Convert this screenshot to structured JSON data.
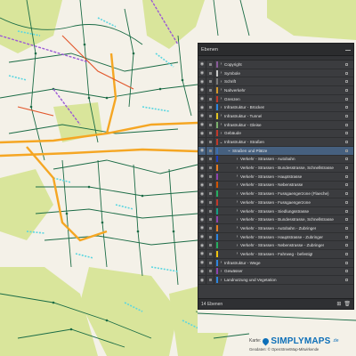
{
  "panel": {
    "title": "Ebenen",
    "footer_count": "14 Ebenen",
    "layers": [
      {
        "label": "Copyright",
        "color": "#8a5a9b",
        "caret": "›",
        "indent": 0
      },
      {
        "label": "Symbole",
        "color": "#c8c8c8",
        "caret": "›",
        "indent": 0
      },
      {
        "label": "Schrift",
        "color": "#7a7a7a",
        "caret": "›",
        "indent": 0
      },
      {
        "label": "Nahverkehr",
        "color": "#d49a2a",
        "caret": "›",
        "indent": 0
      },
      {
        "label": "Grenzen",
        "color": "#c0392b",
        "caret": "›",
        "indent": 0
      },
      {
        "label": "Infrastruktur - Brücken",
        "color": "#2e86de",
        "caret": "›",
        "indent": 0
      },
      {
        "label": "Infrastruktur - Tunnel",
        "color": "#e2c422",
        "caret": "›",
        "indent": 0
      },
      {
        "label": "Infrastruktur - Gleise",
        "color": "#7bb36b",
        "caret": "›",
        "indent": 0
      },
      {
        "label": "Gebäude",
        "color": "#c0392b",
        "caret": "›",
        "indent": 0
      },
      {
        "label": "Infrastruktur - Straßen",
        "color": "#c0392b",
        "caret": "⌄",
        "indent": 0
      },
      {
        "label": "Straßen und Plätze",
        "color": "#3b6fb0",
        "caret": "⌄",
        "indent": 1,
        "selected": true
      },
      {
        "label": "Verkehr - Strassen - Autobahn",
        "color": "#1f3fbf",
        "caret": "›",
        "indent": 2
      },
      {
        "label": "Verkehr - Strassen - Bundesstrasse, Schnellstrasse",
        "color": "#e67e22",
        "caret": "›",
        "indent": 2
      },
      {
        "label": "Verkehr - Strassen - Hauptstrasse",
        "color": "#8e44ad",
        "caret": "›",
        "indent": 2
      },
      {
        "label": "Verkehr - Strassen - Nebenstrasse",
        "color": "#d35400",
        "caret": "›",
        "indent": 2
      },
      {
        "label": "Verkehr - Strassen - Fussgaengerzone (Flaeche)",
        "color": "#27ae60",
        "caret": "›",
        "indent": 2
      },
      {
        "label": "Verkehr - Strassen - Fussgaengerzone",
        "color": "#c0392b",
        "caret": "›",
        "indent": 2
      },
      {
        "label": "Verkehr - Strassen - Siedlungsstrasse",
        "color": "#16a085",
        "caret": "›",
        "indent": 2
      },
      {
        "label": "Verkehr - Strassen - Bundesstrasse, Schnellstrasse",
        "color": "#8e44ad",
        "caret": "›",
        "indent": 2
      },
      {
        "label": "Verkehr - Strassen - Autobahn - Zubringer",
        "color": "#e67e22",
        "caret": "›",
        "indent": 2
      },
      {
        "label": "Verkehr - Strassen - Hauptstrasse - Zubringer",
        "color": "#2e86de",
        "caret": "›",
        "indent": 2
      },
      {
        "label": "Verkehr - Strassen - Nebenstrasse - Zubringer",
        "color": "#27ae60",
        "caret": "›",
        "indent": 2
      },
      {
        "label": "Verkehr - Strassen - Fahrweg - befestigt",
        "color": "#f1c40f",
        "caret": "›",
        "indent": 2
      },
      {
        "label": "Infrastruktur - Wege",
        "color": "#2e86de",
        "caret": "›",
        "indent": 0
      },
      {
        "label": "Gewässer",
        "color": "#8e44ad",
        "caret": "›",
        "indent": 0
      },
      {
        "label": "Landnutzung und Vegetation",
        "color": "#2e86de",
        "caret": "›",
        "indent": 0
      }
    ]
  },
  "logo": {
    "karte": "Karte:",
    "brand": "SIMPLYMAPS",
    "tld": ".de",
    "sub": "Geodaten: © OpenStreetMap-Mitwirkende"
  },
  "colors": {
    "map_background": "#f4f1e8",
    "vegetation": "#d9e59b",
    "residential_roads": "#1a6b45",
    "main_roads": "#f5a623",
    "railway": "#8e44ad",
    "pedestrian": "#5bd6e0"
  }
}
